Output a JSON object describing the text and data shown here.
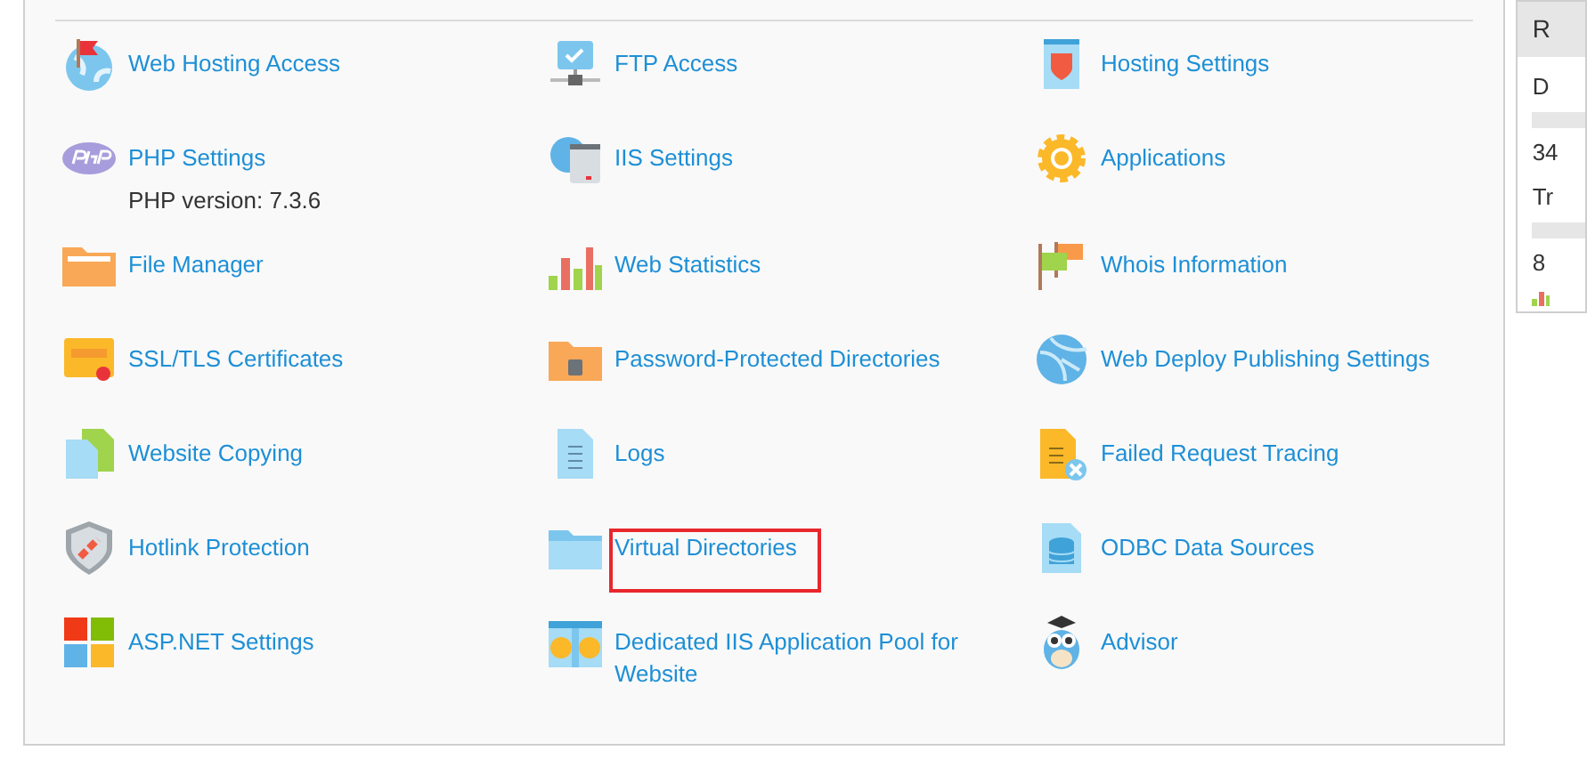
{
  "tools": [
    {
      "label": "Web Hosting Access",
      "highlighted": false
    },
    {
      "label": "FTP Access",
      "highlighted": false
    },
    {
      "label": "Hosting Settings",
      "highlighted": false
    },
    {
      "label": "PHP Settings",
      "note": "PHP version: 7.3.6",
      "highlighted": false
    },
    {
      "label": "IIS Settings",
      "highlighted": false
    },
    {
      "label": "Applications",
      "highlighted": false
    },
    {
      "label": "File Manager",
      "highlighted": false
    },
    {
      "label": "Web Statistics",
      "highlighted": false
    },
    {
      "label": "Whois Information",
      "highlighted": false
    },
    {
      "label": "SSL/TLS Certificates",
      "highlighted": false
    },
    {
      "label": "Password-Protected Directories",
      "highlighted": false
    },
    {
      "label": "Web Deploy Publishing Settings",
      "highlighted": false
    },
    {
      "label": "Website Copying",
      "highlighted": false
    },
    {
      "label": "Logs",
      "highlighted": false
    },
    {
      "label": "Failed Request Tracing",
      "highlighted": false
    },
    {
      "label": "Hotlink Protection",
      "highlighted": false
    },
    {
      "label": "Virtual Directories",
      "highlighted": true
    },
    {
      "label": "ODBC Data Sources",
      "highlighted": false
    },
    {
      "label": "ASP.NET Settings",
      "highlighted": false
    },
    {
      "label": "Dedicated IIS Application Pool for Website",
      "highlighted": false
    },
    {
      "label": "Advisor",
      "highlighted": false
    }
  ],
  "side_panel": {
    "title": "R",
    "lines": [
      {
        "label": "D",
        "value": "34"
      },
      {
        "label": "Tr",
        "value": "8"
      }
    ]
  }
}
